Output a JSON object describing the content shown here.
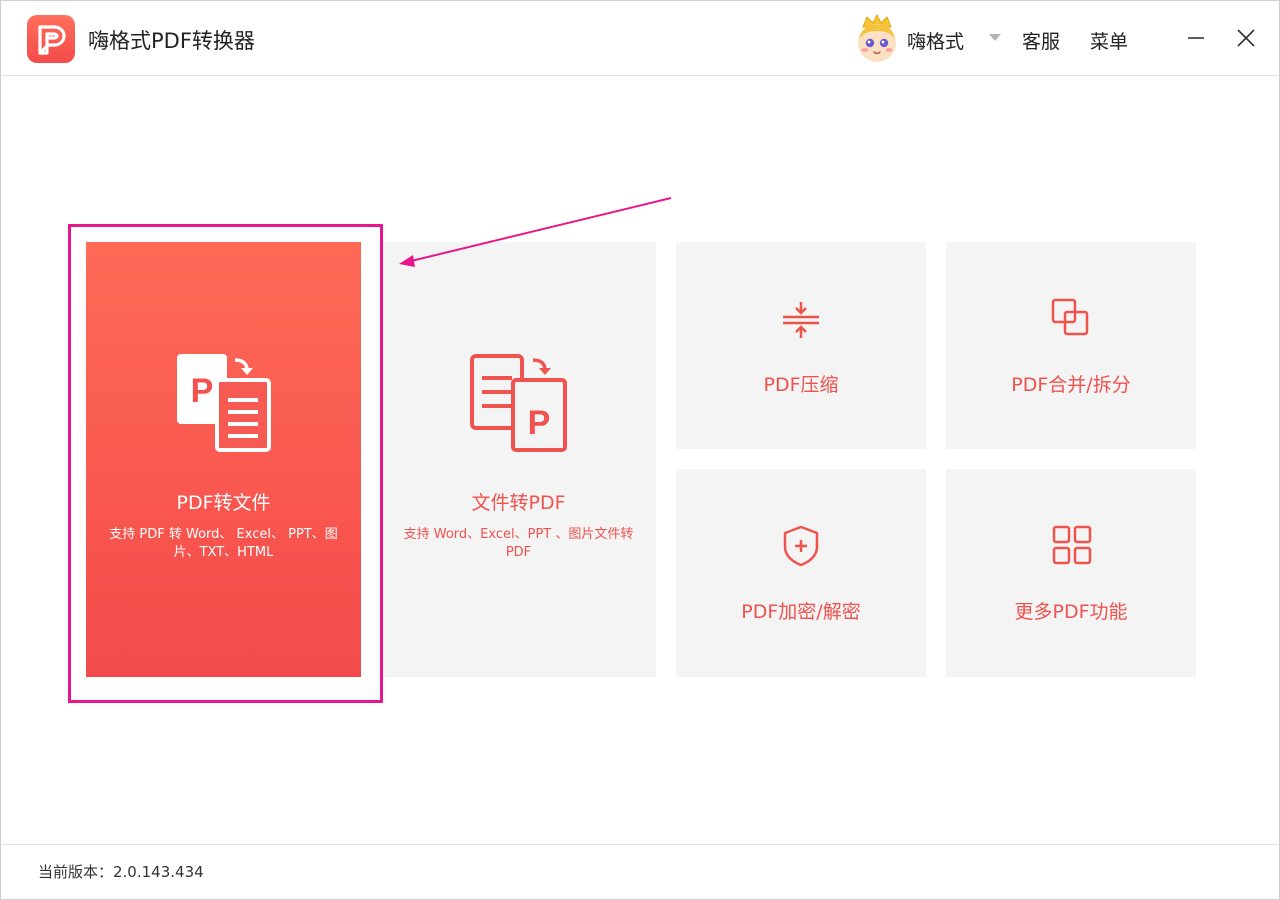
{
  "app": {
    "title": "嗨格式PDF转换器",
    "brand_color": "#f24c4a"
  },
  "header": {
    "username": "嗨格式",
    "service_label": "客服",
    "menu_label": "菜单"
  },
  "tiles": [
    {
      "id": "pdf-to-file",
      "title": "PDF转文件",
      "desc": "支持 PDF 转 Word、 Excel、 PPT、图片、TXT、HTML",
      "icon": "pdf-to-file-icon",
      "highlighted": true
    },
    {
      "id": "file-to-pdf",
      "title": "文件转PDF",
      "desc": "支持 Word、Excel、PPT 、图片文件转 PDF",
      "icon": "file-to-pdf-icon"
    },
    {
      "id": "compress",
      "title": "PDF压缩",
      "icon": "compress-icon"
    },
    {
      "id": "merge-split",
      "title": "PDF合并/拆分",
      "icon": "merge-icon"
    },
    {
      "id": "encrypt",
      "title": "PDF加密/解密",
      "icon": "shield-icon"
    },
    {
      "id": "more",
      "title": "更多PDF功能",
      "icon": "grid-icon"
    }
  ],
  "annotation": {
    "highlight_color": "#e8168c"
  },
  "footer": {
    "version_text": "当前版本：2.0.143.434"
  }
}
